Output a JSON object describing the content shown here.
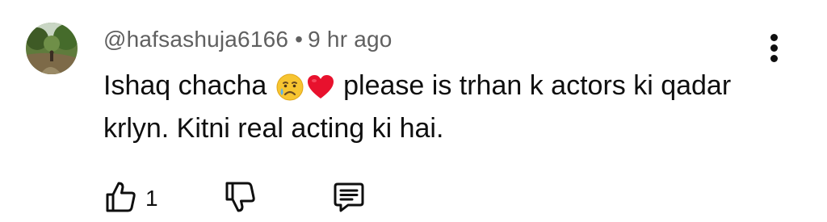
{
  "comment": {
    "author": "@hafsashuja6166",
    "separator": "•",
    "time": "9 hr ago",
    "text_before_emoji": "Ishaq chacha ",
    "emojis": [
      "crying-face-emoji",
      "red-heart-emoji"
    ],
    "text_after_emoji": " please is trhan k actors ki qadar krlyn. Kitni real acting ki hai.",
    "like_count": "1"
  },
  "icons": {
    "more": "more-vertical-icon",
    "like": "thumbs-up-icon",
    "dislike": "thumbs-down-icon",
    "reply": "comment-reply-icon"
  },
  "colors": {
    "meta_text": "#606060",
    "primary_text": "#0f0f0f",
    "background": "#ffffff"
  }
}
